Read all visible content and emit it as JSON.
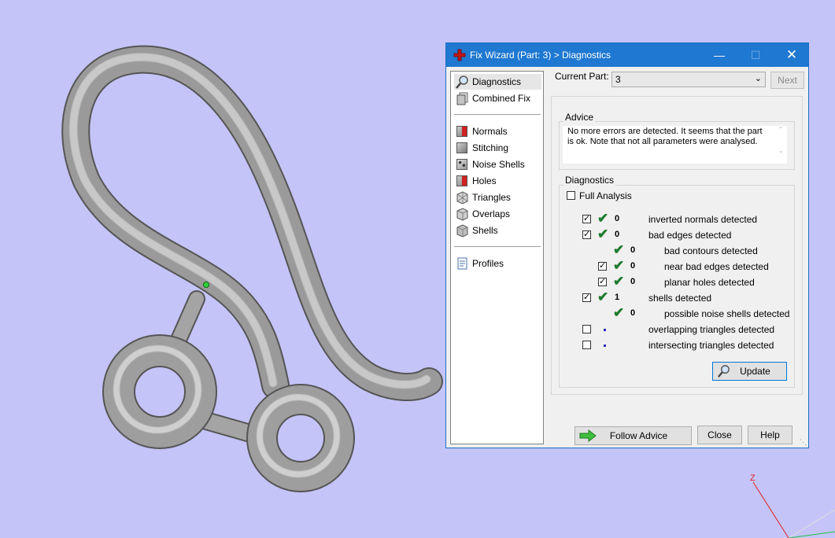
{
  "window": {
    "title": "Fix Wizard (Part: 3) > Diagnostics",
    "minimize": "—",
    "maximize": "☐",
    "close": "✕"
  },
  "nav": {
    "top": [
      {
        "label": "Diagnostics",
        "icon": "magnifier-icon",
        "selected": true
      },
      {
        "label": "Combined Fix",
        "icon": "layers-icon"
      }
    ],
    "steps": [
      {
        "label": "Normals",
        "icon": "normals-cube-icon"
      },
      {
        "label": "Stitching",
        "icon": "stitching-cube-icon"
      },
      {
        "label": "Noise Shells",
        "icon": "noise-shells-cube-icon"
      },
      {
        "label": "Holes",
        "icon": "holes-cube-icon"
      },
      {
        "label": "Triangles",
        "icon": "triangles-cube-icon"
      },
      {
        "label": "Overlaps",
        "icon": "overlaps-cube-icon"
      },
      {
        "label": "Shells",
        "icon": "shells-cube-icon"
      }
    ],
    "bottom": [
      {
        "label": "Profiles",
        "icon": "document-icon"
      }
    ]
  },
  "part": {
    "label": "Current Part:",
    "value": "3",
    "next": "Next"
  },
  "advice": {
    "title": "Advice",
    "text": "No more errors are detected. It seems that the part\nis ok. Note that not all parameters were analysed."
  },
  "diagnostics": {
    "title": "Diagnostics",
    "full_analysis": {
      "label": "Full Analysis",
      "checked": false
    },
    "rows": [
      {
        "checkbox": true,
        "checked": true,
        "status": "ok",
        "count": "0",
        "label": "inverted normals detected",
        "indent": 0
      },
      {
        "checkbox": true,
        "checked": true,
        "status": "ok",
        "count": "0",
        "label": "bad edges detected",
        "indent": 0
      },
      {
        "checkbox": false,
        "checked": false,
        "status": "ok",
        "count": "0",
        "label": "bad contours detected",
        "indent": 1
      },
      {
        "checkbox": true,
        "checked": true,
        "status": "ok",
        "count": "0",
        "label": "near bad edges detected",
        "indent": 1
      },
      {
        "checkbox": true,
        "checked": true,
        "status": "ok",
        "count": "0",
        "label": "planar holes detected",
        "indent": 1
      },
      {
        "checkbox": true,
        "checked": true,
        "status": "ok",
        "count": "1",
        "label": "shells detected",
        "indent": 0
      },
      {
        "checkbox": false,
        "checked": false,
        "status": "ok",
        "count": "0",
        "label": "possible noise shells detected",
        "indent": 1
      },
      {
        "checkbox": true,
        "checked": false,
        "status": "pending",
        "count": "",
        "label": "overlapping triangles detected",
        "indent": 0
      },
      {
        "checkbox": true,
        "checked": false,
        "status": "pending",
        "count": "",
        "label": "intersecting triangles detected",
        "indent": 0
      }
    ],
    "update": "Update"
  },
  "footer": {
    "follow_advice": "Follow Advice",
    "close": "Close",
    "help": "Help"
  },
  "viewport": {
    "axis_label": "Z",
    "background": "#c4c4f8",
    "model_color": "#9a9a9a"
  }
}
